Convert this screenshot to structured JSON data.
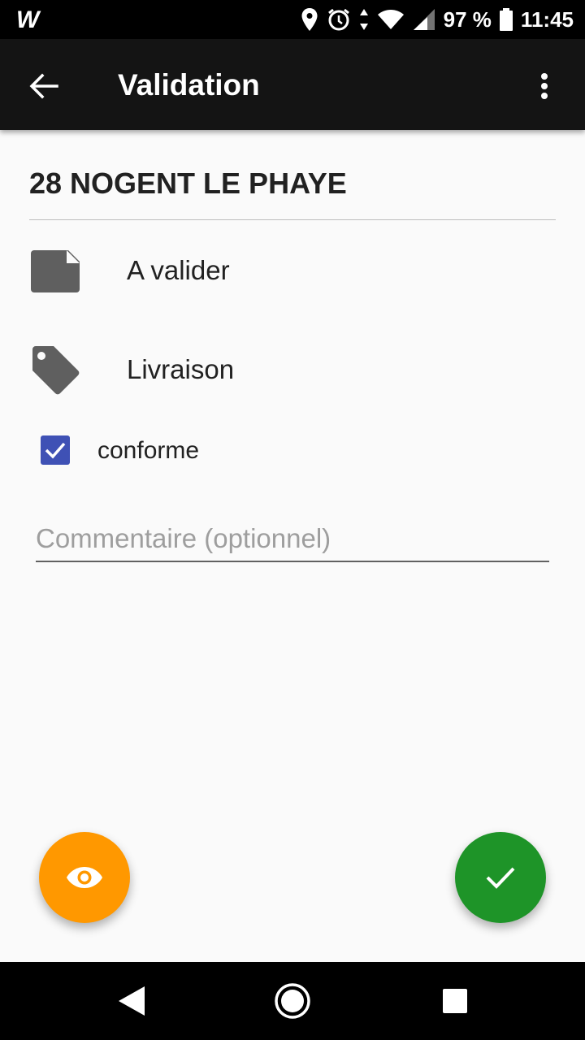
{
  "status_bar": {
    "app_glyph": "W",
    "battery_text": "97 %",
    "time": "11:45",
    "icons": [
      "location-icon",
      "alarm-icon",
      "data-arrows-icon",
      "wifi-icon",
      "signal-icon",
      "battery-icon"
    ]
  },
  "app_bar": {
    "title": "Validation",
    "back_icon": "arrow-back-icon",
    "menu_icon": "more-vert-icon"
  },
  "main": {
    "site_title": "28 NOGENT LE PHAYE",
    "status_label": "A valider",
    "type_label": "Livraison",
    "checkbox_label": "conforme",
    "checkbox_checked": true,
    "comment_placeholder": "Commentaire (optionnel)",
    "comment_value": ""
  },
  "fabs": {
    "view_icon": "eye-icon",
    "confirm_icon": "check-icon"
  },
  "colors": {
    "app_bar": "#141414",
    "checkbox": "#3f51b5",
    "fab_view": "#ff9800",
    "fab_confirm": "#1e9428",
    "icon_grey": "#5f5f5f"
  }
}
